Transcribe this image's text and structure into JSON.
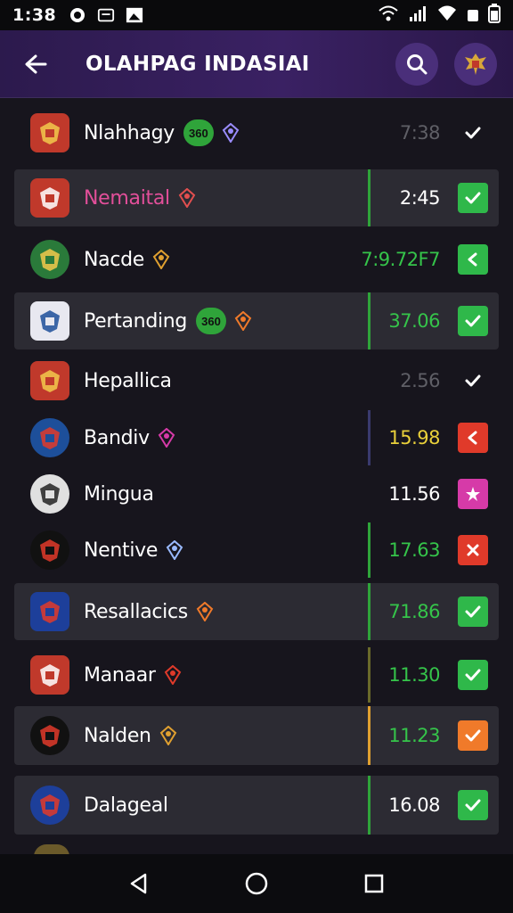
{
  "status_bar": {
    "time": "1:38"
  },
  "app_bar": {
    "title": "OLAHPAG INDASIAI"
  },
  "colors": {
    "appbar": "#3a2163",
    "card": "#2c2b33",
    "green": "#2fb84a",
    "red": "#e03a2a",
    "orange": "#f07a2a",
    "magenta": "#d63aa8"
  },
  "rows": [
    {
      "name": "Nlahhagy",
      "badge": "360",
      "value": "7:38",
      "value_color": "#5f5f66",
      "status": "check-plain",
      "card": false,
      "divider": ""
    },
    {
      "name": "Nemaital",
      "badge": "",
      "value": "2:45",
      "value_color": "#ffffff",
      "name_color": "#e24f9a",
      "status": "green-check",
      "card": true,
      "divider": "#2fa43a"
    },
    {
      "name": "Nacde",
      "badge": "",
      "value": "7:9.72F7",
      "value_color": "#35c44a",
      "status": "green-x",
      "card": false,
      "divider": ""
    },
    {
      "name": "Pertanding",
      "badge": "360",
      "value": "37.06",
      "value_color": "#35c44a",
      "status": "green-check",
      "card": true,
      "divider": "#2fa43a"
    },
    {
      "name": "Hepallica",
      "badge": "",
      "value": "2.56",
      "value_color": "#5f5f66",
      "status": "check-plain",
      "card": false,
      "divider": ""
    },
    {
      "name": "Bandiv",
      "badge": "",
      "value": "15.98",
      "value_color": "#e9d03a",
      "status": "red-x",
      "card": false,
      "divider": "#3a3a6e"
    },
    {
      "name": "Mingua",
      "badge": "",
      "value": "11.56",
      "value_color": "#ffffff",
      "status": "magenta",
      "card": false,
      "divider": ""
    },
    {
      "name": "Nentive",
      "badge": "",
      "value": "17.63",
      "value_color": "#35c44a",
      "status": "red-x",
      "card": false,
      "divider": "#2fa43a"
    },
    {
      "name": "Resallacics",
      "badge": "",
      "value": "71.86",
      "value_color": "#35c44a",
      "status": "green-check",
      "card": true,
      "divider": "#2fa43a"
    },
    {
      "name": "Manaar",
      "badge": "",
      "value": "11.30",
      "value_color": "#35c44a",
      "status": "green-check",
      "card": false,
      "divider": "#6a6a2a"
    },
    {
      "name": "Nalden",
      "badge": "",
      "value": "11.23",
      "value_color": "#35c44a",
      "status": "orange-check",
      "card": true,
      "divider": "#e0a030"
    },
    {
      "name": "Dalageal",
      "badge": "",
      "value": "16.08",
      "value_color": "#ffffff",
      "status": "green-check",
      "card": true,
      "divider": "#2fa43a"
    }
  ]
}
